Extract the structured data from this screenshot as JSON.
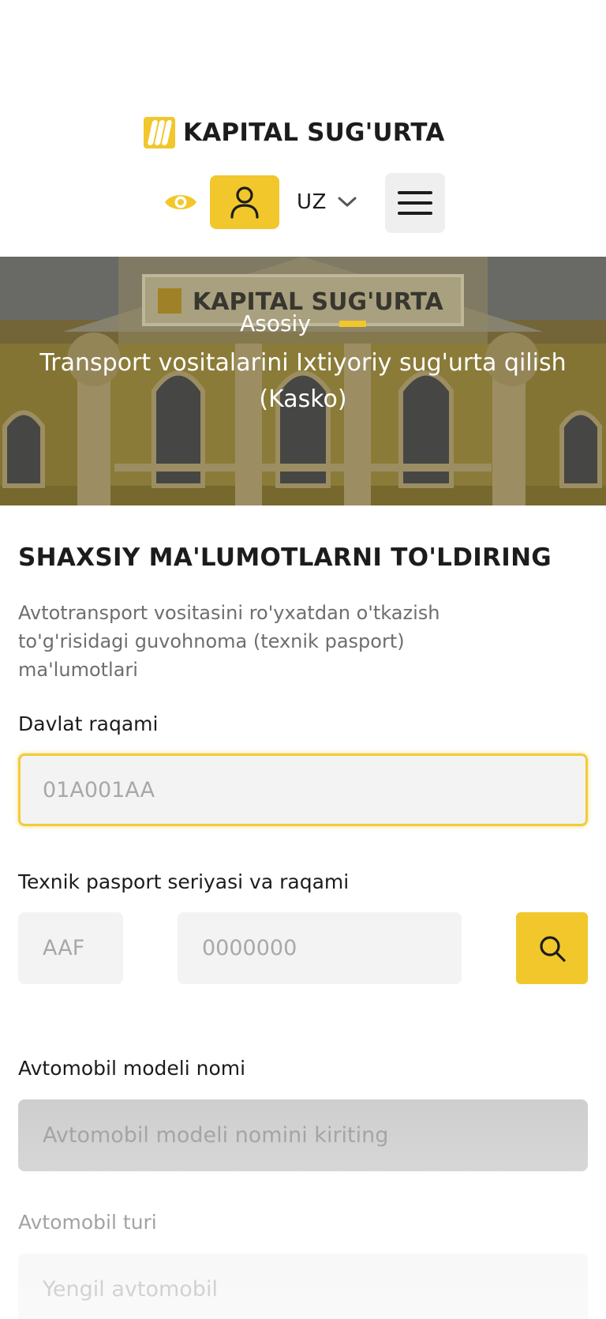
{
  "header": {
    "logo_text": "KAPITAL SUG'URTA",
    "language": "UZ",
    "icons": {
      "accessibility": "eye-icon",
      "profile": "user-icon",
      "language_toggle": "chevron-down-icon",
      "menu": "hamburger-icon"
    }
  },
  "hero": {
    "breadcrumb_home": "Asosiy",
    "title": "Transport vositalarini Ixtiyoriy sug'urta qilish (Kasko)",
    "building_sign": "KAPITAL SUG'URTA"
  },
  "form": {
    "section_title": "SHAXSIY MA'LUMOTLARNI TO'LDIRING",
    "section_description": "Avtotransport vositasini ro'yxatdan o'tkazish to'g'risidagi guvohnoma (texnik pasport) ma'lumotlari",
    "plate": {
      "label": "Davlat raqami",
      "placeholder": "01A001AA",
      "value": ""
    },
    "passport": {
      "label": "Texnik pasport seriyasi va raqami",
      "series_placeholder": "AAF",
      "number_placeholder": "0000000",
      "search_icon": "search-icon"
    },
    "model": {
      "label": "Avtomobil modeli nomi",
      "placeholder": "Avtomobil modeli nomini kiriting"
    },
    "type": {
      "label": "Avtomobil turi",
      "placeholder": "Yengil avtomobil"
    }
  },
  "colors": {
    "accent": "#f1c72b",
    "input_bg": "#f3f3f3",
    "disabled_bg": "#cdcdcd",
    "text": "#1c1c1c",
    "muted": "#6e6e6e"
  }
}
